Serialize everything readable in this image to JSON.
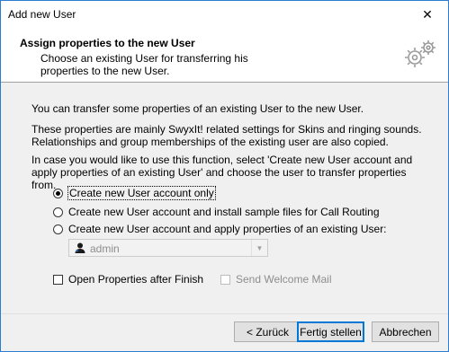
{
  "window": {
    "title": "Add new User",
    "close_glyph": "✕"
  },
  "header": {
    "title": "Assign properties to the new User",
    "subtitle": "Choose an existing User for transferring his properties to the new User.",
    "icon": "gears-icon"
  },
  "body": {
    "intro": "You can transfer some properties of an existing User to the new User.",
    "paragraph2": "These properties are mainly SwyxIt! related settings for Skins and ringing sounds. Relationships and group memberships of the existing user are also copied.",
    "paragraph3": "In case you would like to use this function, select 'Create new User account and apply properties of an existing User' and choose the user to transfer properties from."
  },
  "options": [
    {
      "label": "Create new User account only",
      "selected": true
    },
    {
      "label": "Create new User account and install sample files for Call Routing",
      "selected": false
    },
    {
      "label": "Create new User account and apply properties of an existing User:",
      "selected": false
    }
  ],
  "user_select": {
    "value": "admin",
    "enabled": false,
    "icon": "user-avatar-icon"
  },
  "checkboxes": {
    "open_properties": {
      "label": "Open Properties after Finish",
      "checked": false,
      "enabled": true
    },
    "send_welcome": {
      "label": "Send Welcome Mail",
      "checked": false,
      "enabled": false
    }
  },
  "buttons": {
    "back": "< Zurück",
    "finish": "Fertig stellen",
    "cancel": "Abbrechen"
  },
  "colors": {
    "accent": "#0078d7",
    "disabled_text": "#8d8d8d",
    "window_border": "#2b7cd3"
  }
}
